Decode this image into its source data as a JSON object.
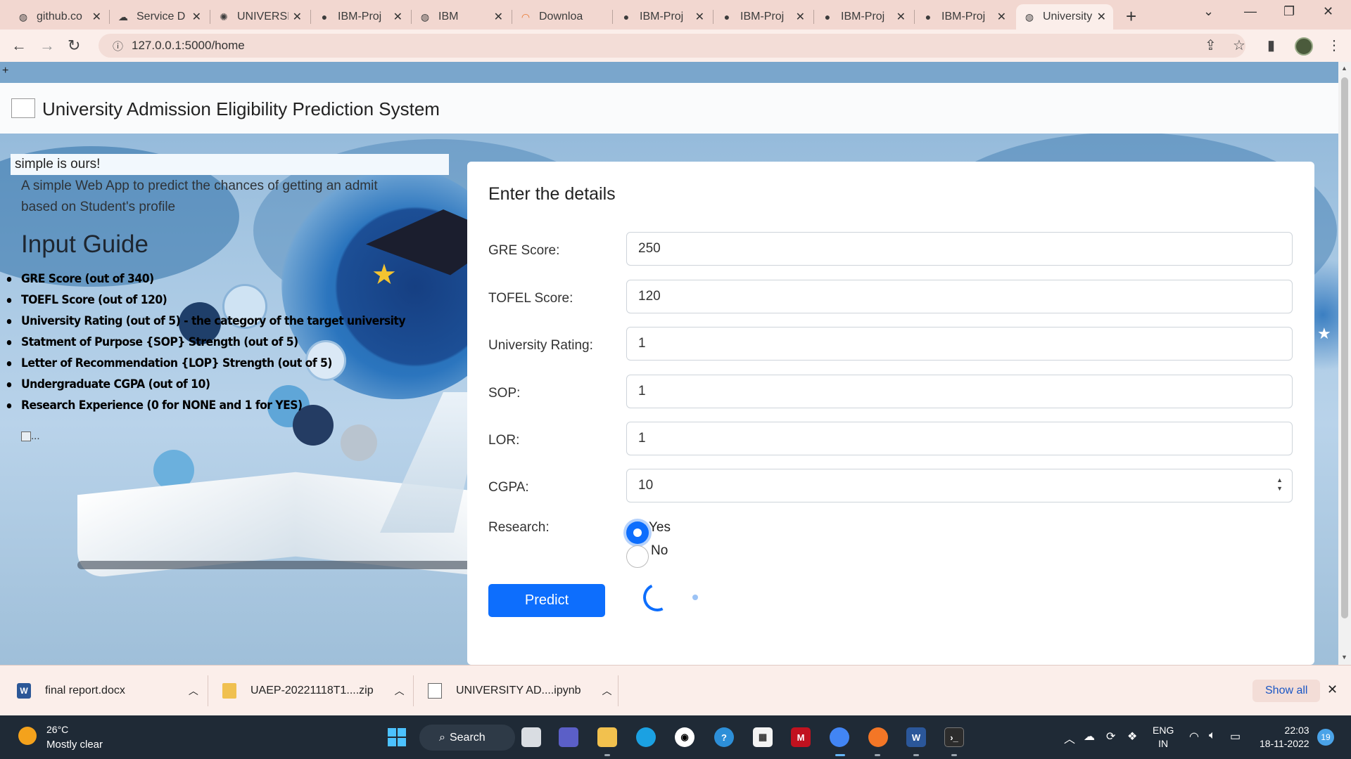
{
  "browser": {
    "tabs": [
      {
        "title": "github.co",
        "icon": "chrome-globe-icon"
      },
      {
        "title": "Service D",
        "icon": "cloud-icon"
      },
      {
        "title": "UNIVERSI",
        "icon": "gear-icon"
      },
      {
        "title": "IBM-Proj",
        "icon": "github-icon"
      },
      {
        "title": "IBM",
        "icon": "globe-icon"
      },
      {
        "title": "Downloa",
        "icon": "loading-icon"
      },
      {
        "title": "IBM-Proj",
        "icon": "github-icon"
      },
      {
        "title": "IBM-Proj",
        "icon": "github-icon"
      },
      {
        "title": "IBM-Proj",
        "icon": "github-icon"
      },
      {
        "title": "IBM-Proj",
        "icon": "github-icon"
      },
      {
        "title": "University",
        "icon": "globe-icon",
        "active": true
      }
    ],
    "url": "127.0.0.1:5000/home",
    "new_tab_symbol": "+"
  },
  "page": {
    "corner_symbol": "+",
    "brand": "University Admission Eligibility Prediction System",
    "tagline": "simple is ours!",
    "subtitle": "A simple Web App to predict the chances of getting an admit based on Student's profile",
    "guide_title": "Input Guide",
    "guide_items": [
      "GRE Score (out of 340)",
      "TOEFL Score (out of 120)",
      "University Rating (out of 5) - the category of the target university",
      "Statment of Purpose {SOP} Strength (out of 5)",
      "Letter of Recommendation {LOP} Strength (out of 5)",
      "Undergraduate CGPA (out of 10)",
      "Research Experience (0 for NONE and 1 for YES)"
    ],
    "broken_image_alt": "..."
  },
  "form": {
    "title": "Enter the details",
    "fields": [
      {
        "label": "GRE Score:",
        "value": "250"
      },
      {
        "label": "TOFEL Score:",
        "value": "120"
      },
      {
        "label": "University Rating:",
        "value": "1"
      },
      {
        "label": "SOP:",
        "value": "1"
      },
      {
        "label": "LOR:",
        "value": "1"
      },
      {
        "label": "CGPA:",
        "value": "10"
      }
    ],
    "research_label": "Research:",
    "research_options": [
      "Yes",
      "No"
    ],
    "research_selected": "Yes",
    "submit_label": "Predict"
  },
  "downloads": {
    "items": [
      {
        "name": "final report.docx",
        "icon": "word-doc-icon"
      },
      {
        "name": "UAEP-20221118T1....zip",
        "icon": "zip-folder-icon"
      },
      {
        "name": "UNIVERSITY AD....ipynb",
        "icon": "file-icon"
      }
    ],
    "show_all": "Show all"
  },
  "taskbar": {
    "temperature": "26°C",
    "weather": "Mostly clear",
    "search": "Search",
    "lang_top": "ENG",
    "lang_bottom": "IN",
    "time": "22:03",
    "date": "18-11-2022",
    "notifications": "19"
  },
  "colors": {
    "accent": "#0d6efd",
    "tabstrip": "#f2d7d0",
    "toolbar": "#fbeeea",
    "taskbar": "#1f2a36"
  }
}
